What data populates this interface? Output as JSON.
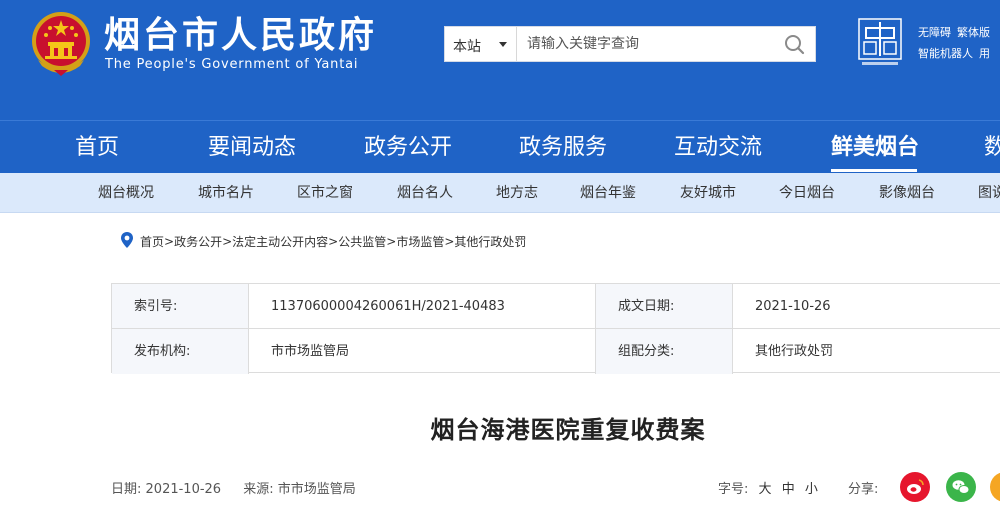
{
  "header": {
    "title": "烟台市人民政府",
    "subtitle": "The People's Government of Yantai",
    "search": {
      "scope": "本站",
      "placeholder": "请输入关键字查询"
    },
    "utility_links": [
      "无障碍",
      "繁体版",
      "智能机器人",
      "用"
    ]
  },
  "main_nav": [
    "首页",
    "要闻动态",
    "政务公开",
    "政务服务",
    "互动交流",
    "鲜美烟台",
    "数"
  ],
  "main_nav_active": "鲜美烟台",
  "sub_nav": [
    "烟台概况",
    "城市名片",
    "区市之窗",
    "烟台名人",
    "地方志",
    "烟台年鉴",
    "友好城市",
    "今日烟台",
    "影像烟台",
    "图说"
  ],
  "breadcrumb": {
    "items": [
      "首页",
      "政务公开",
      "法定主动公开内容",
      "公共监管",
      "市场监管",
      "其他行政处罚"
    ],
    "separator": ">"
  },
  "meta": {
    "index_label": "索引号:",
    "index_value": "11370600004260061H/2021-40483",
    "date_label": "成文日期:",
    "date_value": "2021-10-26",
    "org_label": "发布机构:",
    "org_value": "市市场监管局",
    "category_label": "组配分类:",
    "category_value": "其他行政处罚"
  },
  "article": {
    "title": "烟台海港医院重复收费案",
    "date_label": "日期:",
    "date": "2021-10-26",
    "source_label": "来源:",
    "source": "市市场监管局",
    "font_size_label": "字号:",
    "font_sizes": [
      "大",
      "中",
      "小"
    ],
    "share_label": "分享:"
  },
  "colors": {
    "primary_blue": "#1f63c6",
    "subnav_bg": "#dbe9fb",
    "weibo_red": "#e6162d",
    "wechat_green": "#3bb54a",
    "share_orange": "#f5a623"
  },
  "icons": [
    "national-emblem-icon",
    "search-icon",
    "china-gov-logo-icon",
    "location-pin-icon",
    "weibo-icon",
    "wechat-icon",
    "share-more-icon"
  ]
}
